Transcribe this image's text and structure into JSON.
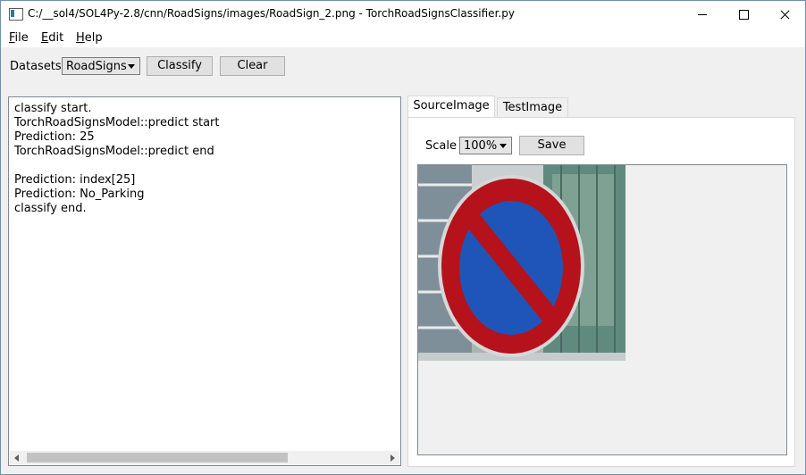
{
  "window": {
    "title": "C:/__sol4/SOL4Py-2.8/cnn/RoadSigns/images/RoadSign_2.png - TorchRoadSignsClassifier.py"
  },
  "menu": [
    "File",
    "Edit",
    "Help"
  ],
  "toolbar": {
    "datasets_label": "Datasets",
    "datasets_value": "RoadSigns",
    "classify_label": "Classify",
    "clear_label": "Clear"
  },
  "log": [
    "classify start.",
    "TorchRoadSignsModel::predict start",
    "Prediction: 25",
    "TorchRoadSignsModel::predict end",
    "",
    "Prediction: index[25]",
    "Prediction: No_Parking",
    "classify end."
  ],
  "tabs": [
    "SourceImage",
    "TestImage"
  ],
  "image_tab": {
    "scale_label": "Scale",
    "scale_value": "100%",
    "save_label": "Save"
  },
  "colors": {
    "sign_red": "#b5121b",
    "sign_blue": "#1f55b8"
  }
}
